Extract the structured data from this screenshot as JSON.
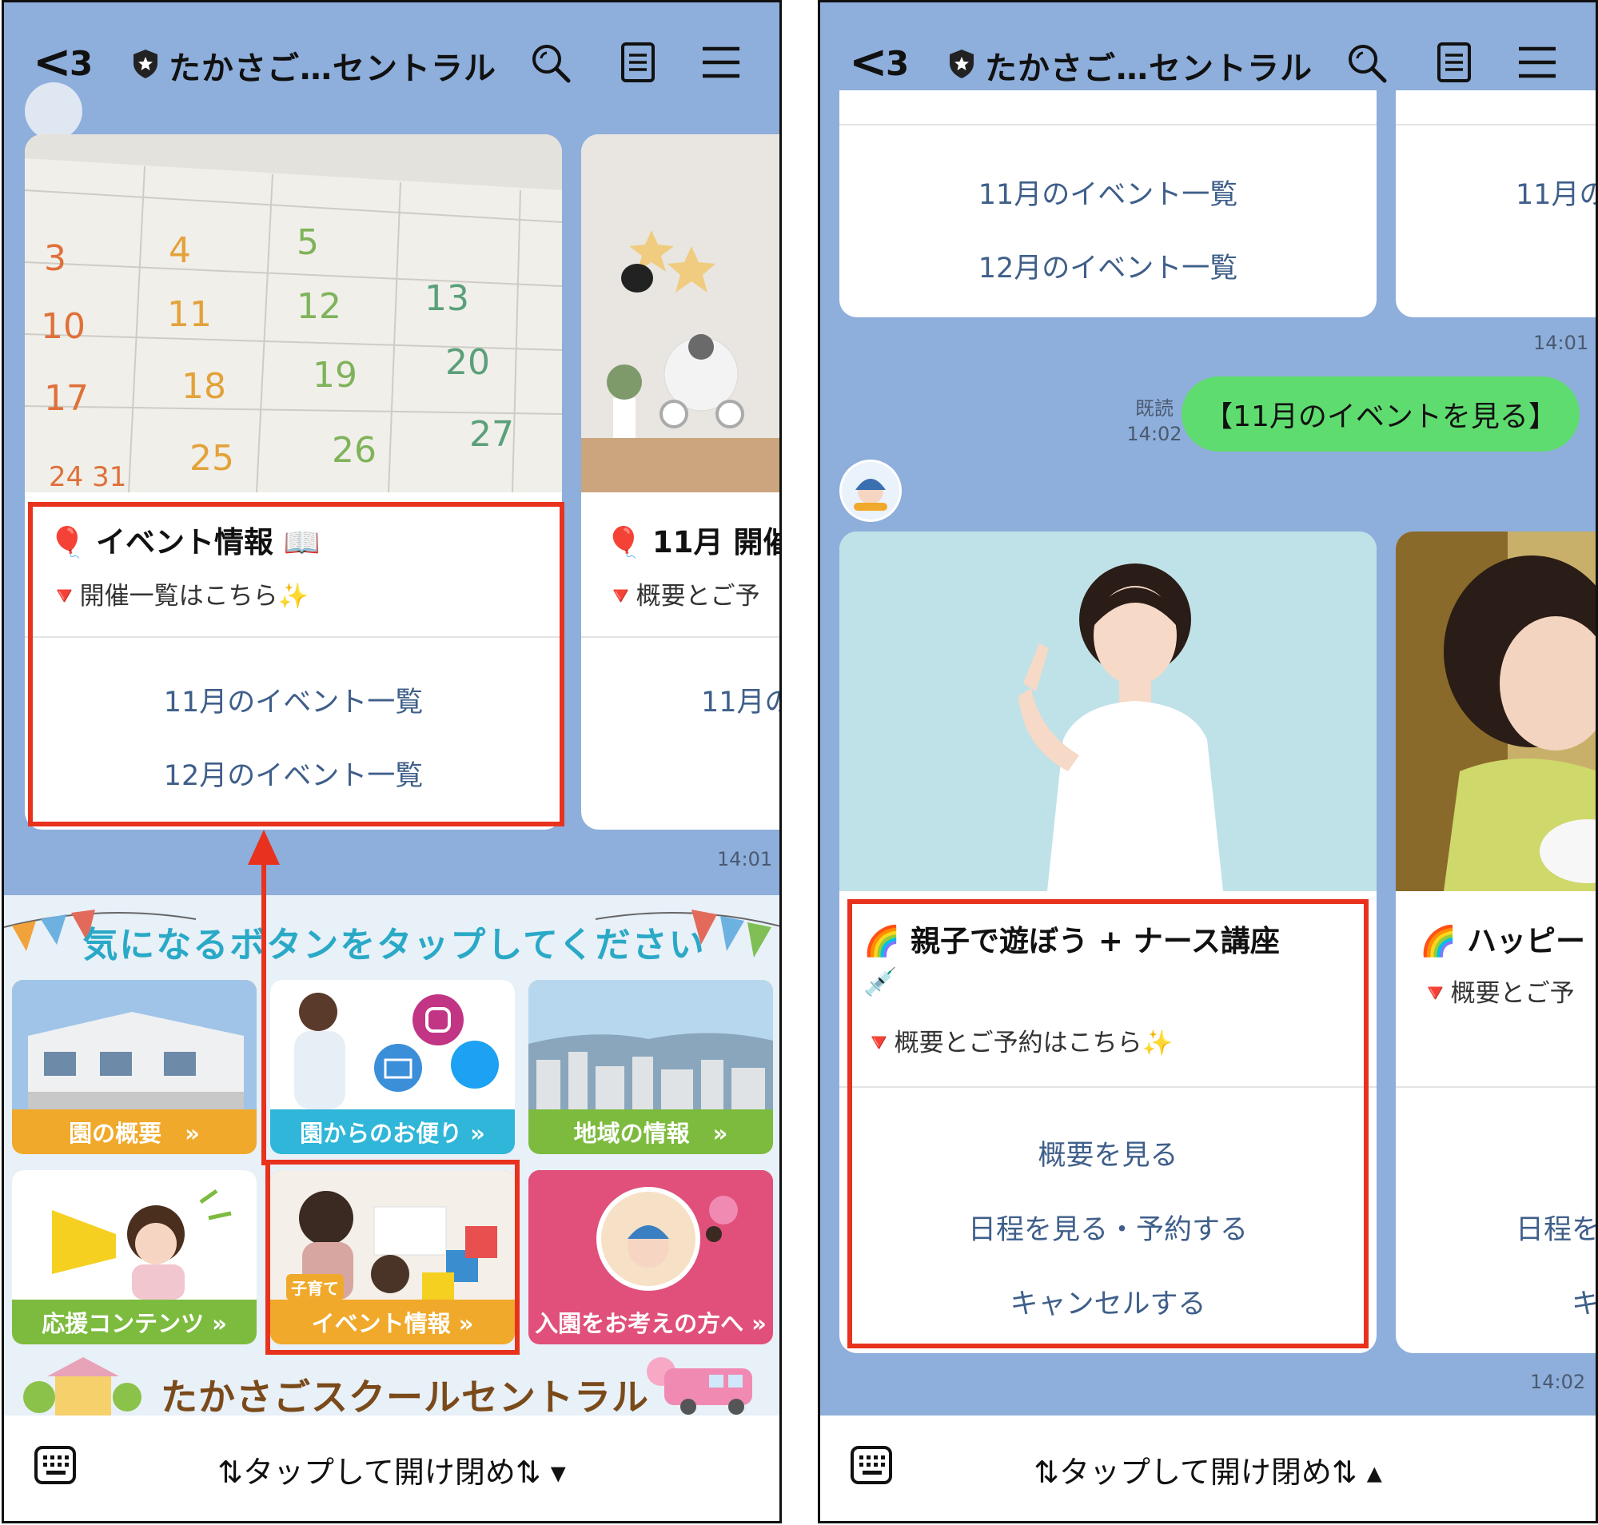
{
  "left": {
    "header": {
      "back": "<",
      "count": "3",
      "title": "たかさご…セントラル"
    },
    "card1": {
      "title": "🎈 イベント情報 📖",
      "subtitle": "🔻開催一覧はこちら✨",
      "actions": [
        "11月のイベント一覧",
        "12月のイベント一覧"
      ]
    },
    "card2": {
      "title": "🎈 11月 開催",
      "subtitle": "🔻概要とご予",
      "action": "11月の"
    },
    "timestamp": "14:01",
    "richmenu": {
      "banner": "気になるボタンをタップしてください",
      "tiles": [
        "園の概要　»",
        "園からのお便り »",
        "地域の情報　»",
        "応援コンテンツ »",
        "イベント情報 »",
        "入園をお考えの方へ »"
      ],
      "event_tag": "子育て",
      "footer_brand": "たかさごスクールセントラル"
    },
    "bottom": {
      "label": "⇅タップして開け閉め⇅ ▾"
    }
  },
  "right": {
    "header": {
      "back": "<",
      "count": "3",
      "title": "たかさご…セントラル"
    },
    "top_card": {
      "actions": [
        "11月のイベント一覧",
        "12月のイベント一覧"
      ],
      "peek": "11月の"
    },
    "timestamp1": "14:01",
    "read_label": "既読",
    "read_time": "14:02",
    "sent_message": "【11月のイベントを見る】",
    "card1": {
      "title": "🌈 親子で遊ぼう + ナース講座",
      "emoji": "💉",
      "subtitle": "🔻概要とご予約はこちら✨",
      "actions": [
        "概要を見る",
        "日程を見る・予約する",
        "キャンセルする"
      ]
    },
    "card2": {
      "title": "🌈 ハッピー",
      "subtitle": "🔻概要とご予",
      "actions": [
        "日程を",
        "キ"
      ]
    },
    "timestamp2": "14:02",
    "bottom": {
      "label": "⇅タップして開け閉め⇅ ▴"
    }
  },
  "colors": {
    "highlight": "#e8321e",
    "chat_bg": "#8eaedb",
    "sent_bubble": "#5fdc6f",
    "link": "#3f5f8a"
  }
}
